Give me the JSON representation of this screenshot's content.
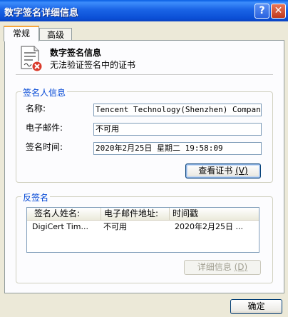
{
  "window": {
    "title": "数字签名详细信息",
    "help_glyph": "?",
    "close_glyph": "✕"
  },
  "tabs": [
    {
      "label": "常规",
      "active": true
    },
    {
      "label": "高级",
      "active": false
    }
  ],
  "header": {
    "title": "数字签名信息",
    "subtitle": "无法验证签名中的证书"
  },
  "signer": {
    "group_title": "签名人信息",
    "name_label": "名称:",
    "name_value": "Tencent Technology(Shenzhen) Company L:",
    "email_label": "电子邮件:",
    "email_value": "不可用",
    "time_label": "签名时间:",
    "time_value": "2020年2月25日 星期二 19:58:09",
    "view_cert_label": "查看证书",
    "view_cert_key": "(V)"
  },
  "countersign": {
    "group_title": "反签名",
    "columns": [
      "签名人姓名:",
      "电子邮件地址:",
      "时间戳"
    ],
    "rows": [
      [
        "DigiCert Tim...",
        "不可用",
        "2020年2月25日 ..."
      ]
    ],
    "details_label": "详细信息",
    "details_key": "(D)"
  },
  "footer": {
    "ok_label": "确定"
  },
  "colors": {
    "titlebar": "#0b4fd6",
    "group_title": "#0046d5",
    "dialog_bg": "#ece9d8",
    "error_red": "#d93a2b"
  }
}
